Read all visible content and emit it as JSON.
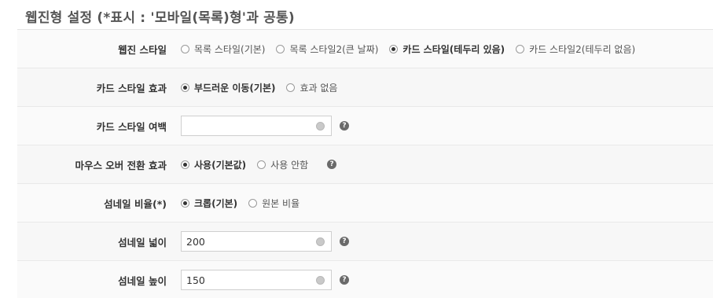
{
  "section_title": "웹진형 설정 (*표시 : '모바일(목록)형'과 공통)",
  "icons": {
    "radio": "radio-button-icon",
    "input_button": "globe-icon",
    "help": "help-icon"
  },
  "help_symbol": "?",
  "rows": [
    {
      "label": "웹진 스타일",
      "options": [
        "목록 스타일(기본)",
        "목록 스타일2(큰 날짜)",
        "카드 스타일(테두리 있음)",
        "카드 스타일2(테두리 없음)"
      ],
      "selected": 2
    },
    {
      "label": "카드 스타일 효과",
      "options": [
        "부드러운 이동(기본)",
        "효과 없음"
      ],
      "selected": 0
    },
    {
      "label": "카드 스타일 여백",
      "value": "",
      "placeholder": ""
    },
    {
      "label": "마우스 오버 전환 효과",
      "options": [
        "사용(기본값)",
        "사용 안함"
      ],
      "selected": 0
    },
    {
      "label": "섬네일 비율(*)",
      "options": [
        "크롭(기본)",
        "원본 비율"
      ],
      "selected": 0
    },
    {
      "label": "섬네일 넓이",
      "value": "200",
      "placeholder": ""
    },
    {
      "label": "섬네일 높이",
      "value": "150",
      "placeholder": ""
    }
  ]
}
